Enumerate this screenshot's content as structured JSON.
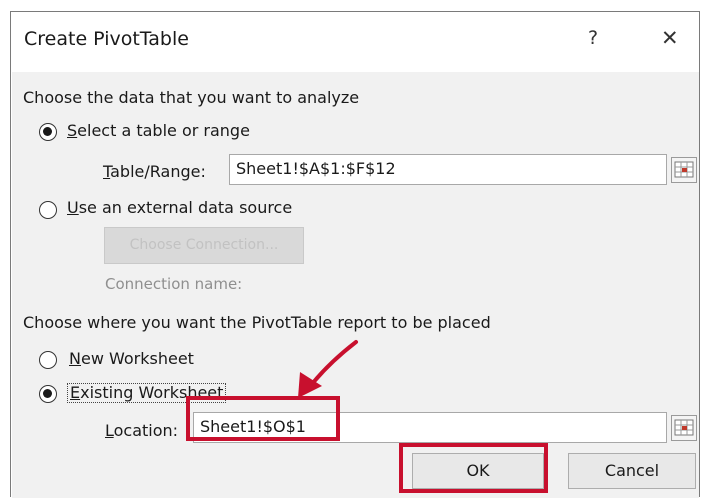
{
  "dialog": {
    "title": "Create PivotTable",
    "help": "?",
    "close": "✕"
  },
  "data_section": {
    "heading": "Choose the data that you want to analyze",
    "option_table_range": "Select a table or range",
    "table_range_label": "Table/Range:",
    "table_range_value": "Sheet1!$A$1:$F$12",
    "option_external": "Use an external data source",
    "choose_connection": "Choose Connection...",
    "connection_name_label": "Connection name:"
  },
  "placement_section": {
    "heading": "Choose where you want the PivotTable report to be placed",
    "option_new": "New Worksheet",
    "option_existing": "Existing Worksheet",
    "location_label": "Location:",
    "location_value": "Sheet1!$O$1"
  },
  "buttons": {
    "ok": "OK",
    "cancel": "Cancel"
  },
  "state": {
    "data_source": "table_or_range",
    "placement": "existing_worksheet"
  },
  "colors": {
    "highlight": "#c8102e",
    "dialog_body": "#f1f1f1"
  },
  "icons": [
    "range-select-icon",
    "arrow-annotation"
  ]
}
